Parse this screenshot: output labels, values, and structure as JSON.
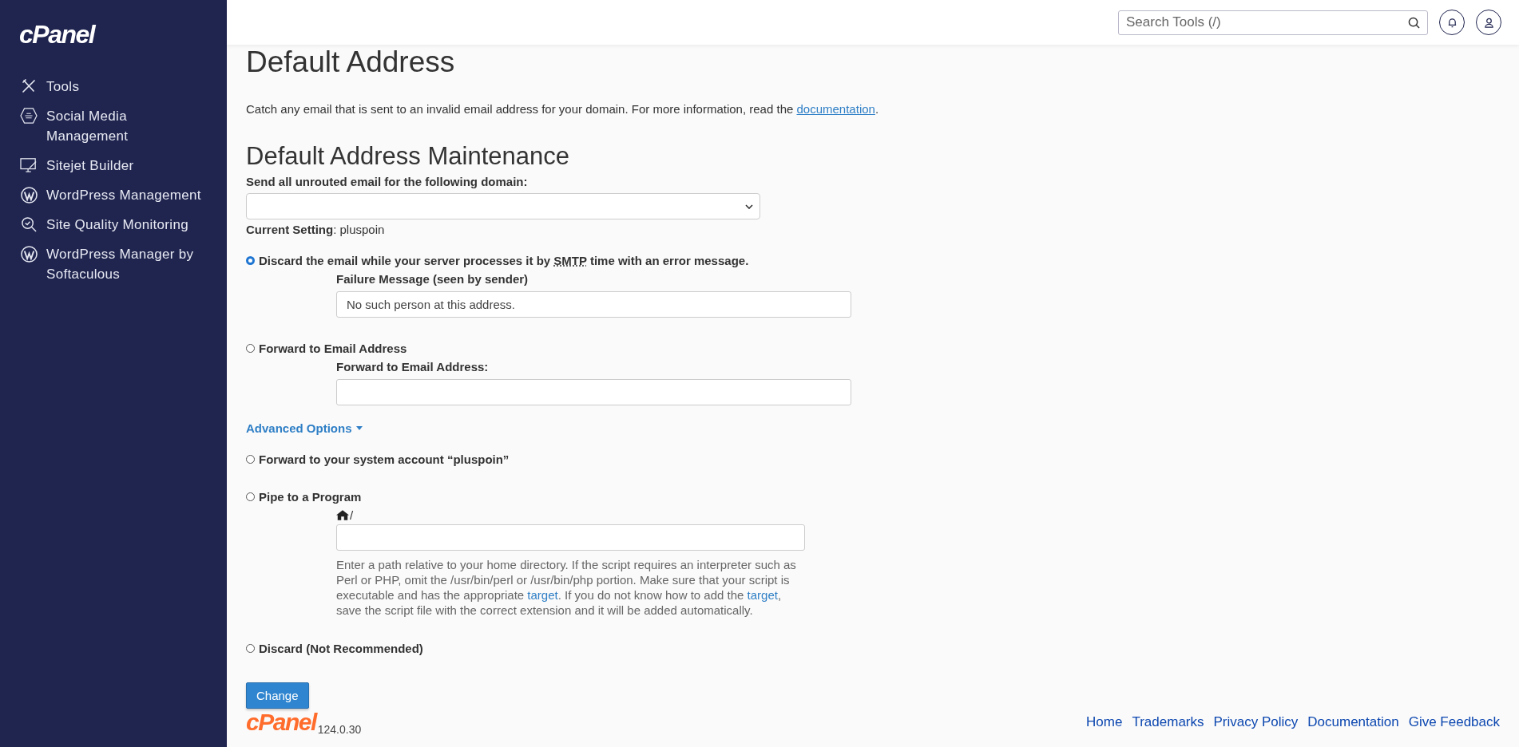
{
  "sidebar": {
    "logo": "cPanel",
    "items": [
      {
        "label": "Tools",
        "selected": false
      },
      {
        "label": "Social Media Management",
        "selected": false
      },
      {
        "label": "Sitejet Builder",
        "selected": false
      },
      {
        "label": "WordPress Management",
        "selected": false
      },
      {
        "label": "Site Quality Monitoring",
        "selected": false
      },
      {
        "label": "WordPress Manager by Softaculous",
        "selected": false
      }
    ]
  },
  "topbar": {
    "search": {
      "placeholder": "Search Tools (/)"
    }
  },
  "page": {
    "title": "Default Address",
    "description": [
      {
        "kind": "text",
        "text": "Catch any email that is sent to an invalid email address for your domain. For more information, read the "
      },
      {
        "kind": "link",
        "text": "documentation"
      },
      {
        "kind": "text",
        "text": "."
      }
    ],
    "section_title": "Default Address Maintenance",
    "domain_label": "Send all unrouted email for the following domain:",
    "current_setting": {
      "label": "Current Setting",
      "value": ": pluspoin"
    },
    "options": [
      {
        "selected": true,
        "label": [
          {
            "kind": "text",
            "text": "Discard the email while your server processes it by "
          },
          {
            "kind": "abbr",
            "text": "SMTP"
          },
          {
            "kind": "text",
            "text": " time with an error message."
          }
        ],
        "field": {
          "kind": "text",
          "label": "Failure Message (seen by sender)",
          "value": "No such person at this address."
        }
      },
      {
        "selected": false,
        "label": [
          {
            "kind": "text",
            "text": "Forward to Email Address"
          }
        ],
        "field": {
          "kind": "text",
          "label": "Forward to Email Address:"
        }
      }
    ],
    "advanced_toggle": "Advanced Options",
    "advanced_options": [
      {
        "selected": false,
        "label": [
          {
            "kind": "text",
            "text": "Forward to your system account “pluspoin”"
          }
        ]
      },
      {
        "selected": false,
        "label": [
          {
            "kind": "text",
            "text": "Pipe to a Program"
          }
        ],
        "field": {
          "kind": "home-path",
          "label": "/",
          "help": [
            {
              "kind": "text",
              "text": "Enter a path relative to your home directory. If the script requires an interpreter such as Perl or PHP, omit the /usr/bin/perl or /usr/bin/php portion. Make sure that your script is executable and has the appropriate "
            },
            {
              "kind": "link",
              "text": "target"
            },
            {
              "kind": "text",
              "text": ". If you do not know how to add the "
            },
            {
              "kind": "link",
              "text": "target"
            },
            {
              "kind": "text",
              "text": ", save the script file with the correct extension and it will be added automatically."
            }
          ]
        }
      },
      {
        "selected": false,
        "label": [
          {
            "kind": "text",
            "text": "Discard (Not Recommended)"
          }
        ]
      }
    ],
    "submit": "Change"
  },
  "footer": {
    "logo": "cPanel",
    "version": "124.0.30",
    "links": [
      "Home",
      "Trademarks",
      "Privacy Policy",
      "Documentation",
      "Give Feedback"
    ]
  }
}
